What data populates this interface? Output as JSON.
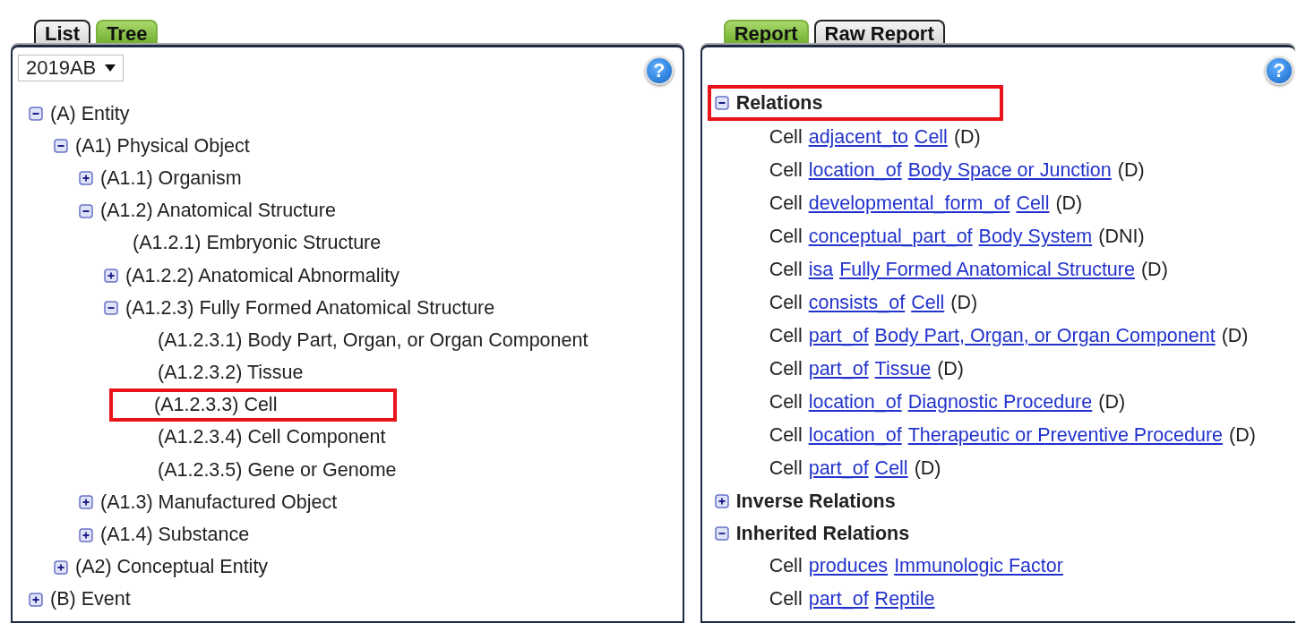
{
  "left_panel": {
    "tabs": [
      {
        "label": "List",
        "selected": false
      },
      {
        "label": "Tree",
        "selected": true
      }
    ],
    "version_select": {
      "value": "2019AB"
    },
    "help_button": {
      "label": "?"
    },
    "tree": [
      {
        "label": "(A) Entity",
        "kind": "branch",
        "expanded": true,
        "highlighted": false,
        "children": [
          {
            "label": "(A1) Physical Object",
            "kind": "branch",
            "expanded": true,
            "highlighted": false,
            "children": [
              {
                "label": "(A1.1) Organism",
                "kind": "branch",
                "expanded": false,
                "highlighted": false
              },
              {
                "label": "(A1.2) Anatomical Structure",
                "kind": "branch",
                "expanded": true,
                "highlighted": false,
                "children": [
                  {
                    "label": "(A1.2.1) Embryonic Structure",
                    "kind": "leaf",
                    "highlighted": false
                  },
                  {
                    "label": "(A1.2.2) Anatomical Abnormality",
                    "kind": "branch",
                    "expanded": false,
                    "highlighted": false
                  },
                  {
                    "label": "(A1.2.3) Fully Formed Anatomical Structure",
                    "kind": "branch",
                    "expanded": true,
                    "highlighted": false,
                    "children": [
                      {
                        "label": "(A1.2.3.1) Body Part, Organ, or Organ Component",
                        "kind": "leaf",
                        "highlighted": false
                      },
                      {
                        "label": "(A1.2.3.2) Tissue",
                        "kind": "leaf",
                        "highlighted": false
                      },
                      {
                        "label": "(A1.2.3.3) Cell",
                        "kind": "leaf",
                        "highlighted": true
                      },
                      {
                        "label": "(A1.2.3.4) Cell Component",
                        "kind": "leaf",
                        "highlighted": false
                      },
                      {
                        "label": "(A1.2.3.5) Gene or Genome",
                        "kind": "leaf",
                        "highlighted": false
                      }
                    ]
                  }
                ]
              },
              {
                "label": "(A1.3) Manufactured Object",
                "kind": "branch",
                "expanded": false,
                "highlighted": false
              },
              {
                "label": "(A1.4) Substance",
                "kind": "branch",
                "expanded": false,
                "highlighted": false
              }
            ]
          },
          {
            "label": "(A2) Conceptual Entity",
            "kind": "branch",
            "expanded": false,
            "highlighted": false
          }
        ]
      },
      {
        "label": "(B) Event",
        "kind": "branch",
        "expanded": false,
        "highlighted": false
      }
    ]
  },
  "right_panel": {
    "tabs": [
      {
        "label": "Report",
        "selected": true
      },
      {
        "label": "Raw Report",
        "selected": false
      }
    ],
    "help_button": {
      "label": "?"
    },
    "sections": [
      {
        "title": "Relations",
        "expanded": true,
        "highlighted": true,
        "rows": [
          {
            "subject": "Cell",
            "relation": "adjacent_to",
            "target": "Cell",
            "note": "(D)"
          },
          {
            "subject": "Cell",
            "relation": "location_of",
            "target": "Body Space or Junction",
            "note": "(D)"
          },
          {
            "subject": "Cell",
            "relation": "developmental_form_of",
            "target": "Cell",
            "note": "(D)"
          },
          {
            "subject": "Cell",
            "relation": "conceptual_part_of",
            "target": "Body System",
            "note": "(DNI)"
          },
          {
            "subject": "Cell",
            "relation": "isa",
            "target": "Fully Formed Anatomical Structure",
            "note": "(D)"
          },
          {
            "subject": "Cell",
            "relation": "consists_of",
            "target": "Cell",
            "note": "(D)"
          },
          {
            "subject": "Cell",
            "relation": "part_of",
            "target": "Body Part, Organ, or Organ Component",
            "note": "(D)"
          },
          {
            "subject": "Cell",
            "relation": "part_of",
            "target": "Tissue",
            "note": "(D)"
          },
          {
            "subject": "Cell",
            "relation": "location_of",
            "target": "Diagnostic Procedure",
            "note": "(D)"
          },
          {
            "subject": "Cell",
            "relation": "location_of",
            "target": "Therapeutic or Preventive Procedure",
            "note": "(D)"
          },
          {
            "subject": "Cell",
            "relation": "part_of",
            "target": "Cell",
            "note": "(D)"
          }
        ]
      },
      {
        "title": "Inverse Relations",
        "expanded": false,
        "highlighted": false
      },
      {
        "title": "Inherited Relations",
        "expanded": true,
        "highlighted": false,
        "rows": [
          {
            "subject": "Cell",
            "relation": "produces",
            "target": "Immunologic Factor"
          },
          {
            "subject": "Cell",
            "relation": "part_of",
            "target": "Reptile"
          }
        ]
      }
    ]
  }
}
